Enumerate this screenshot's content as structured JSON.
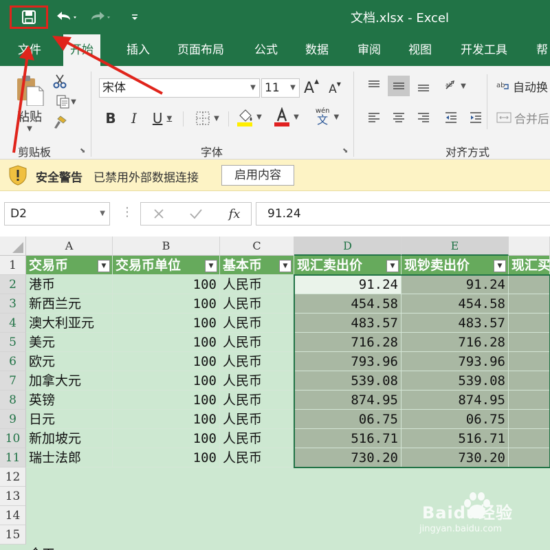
{
  "window": {
    "title": "文档.xlsx  -  Excel"
  },
  "tabs": [
    "文件",
    "开始",
    "插入",
    "页面布局",
    "公式",
    "数据",
    "审阅",
    "视图",
    "开发工具",
    "帮"
  ],
  "ribbon": {
    "clipboard": {
      "paste": "粘贴",
      "label": "剪贴板"
    },
    "font": {
      "name": "宋体",
      "size": "11",
      "label": "字体",
      "bold": "B",
      "italic": "I",
      "underline": "U",
      "grow": "A",
      "shrink": "A",
      "phonetic_top": "wén",
      "phonetic_bottom": "文"
    },
    "alignment": {
      "wrap": "自动换",
      "merge": "合并后",
      "label": "对齐方式"
    }
  },
  "security": {
    "title": "安全警告",
    "message": "已禁用外部数据连接",
    "button": "启用内容"
  },
  "formula_bar": {
    "name_box": "D2",
    "fx": "fx",
    "value": "91.24"
  },
  "grid": {
    "columns": [
      "A",
      "B",
      "C",
      "D",
      "E",
      ""
    ],
    "rows": [
      "1",
      "2",
      "3",
      "4",
      "5",
      "6",
      "7",
      "8",
      "9",
      "10",
      "11",
      "12",
      "13",
      "14",
      "15"
    ],
    "headers": [
      "交易币",
      "交易币单位",
      "基本币",
      "现汇卖出价",
      "现钞卖出价",
      "现汇买"
    ],
    "data": [
      [
        "港币",
        "100",
        "人民币",
        "91.24",
        "91.24"
      ],
      [
        "新西兰元",
        "100",
        "人民币",
        "454.58",
        "454.58"
      ],
      [
        "澳大利亚元",
        "100",
        "人民币",
        "483.57",
        "483.57"
      ],
      [
        "美元",
        "100",
        "人民币",
        "716.28",
        "716.28"
      ],
      [
        "欧元",
        "100",
        "人民币",
        "793.96",
        "793.96"
      ],
      [
        "加拿大元",
        "100",
        "人民币",
        "539.08",
        "539.08"
      ],
      [
        "英镑",
        "100",
        "人民币",
        "874.95",
        "874.95"
      ],
      [
        "日元",
        "100",
        "人民币",
        "06.75",
        "06.75"
      ],
      [
        "新加坡元",
        "100",
        "人民币",
        "516.71",
        "516.71"
      ],
      [
        "瑞士法郎",
        "100",
        "人民币",
        "730.20",
        "730.20"
      ]
    ],
    "partial": "合工"
  },
  "watermark": {
    "brand": "Baidu经验",
    "url": "jingyan.baidu.com"
  },
  "colors": {
    "excel_green": "#217346",
    "header_fill": "#66aa5c",
    "annotation_red": "#e0241b",
    "warning_bar": "#fdf3c5"
  }
}
